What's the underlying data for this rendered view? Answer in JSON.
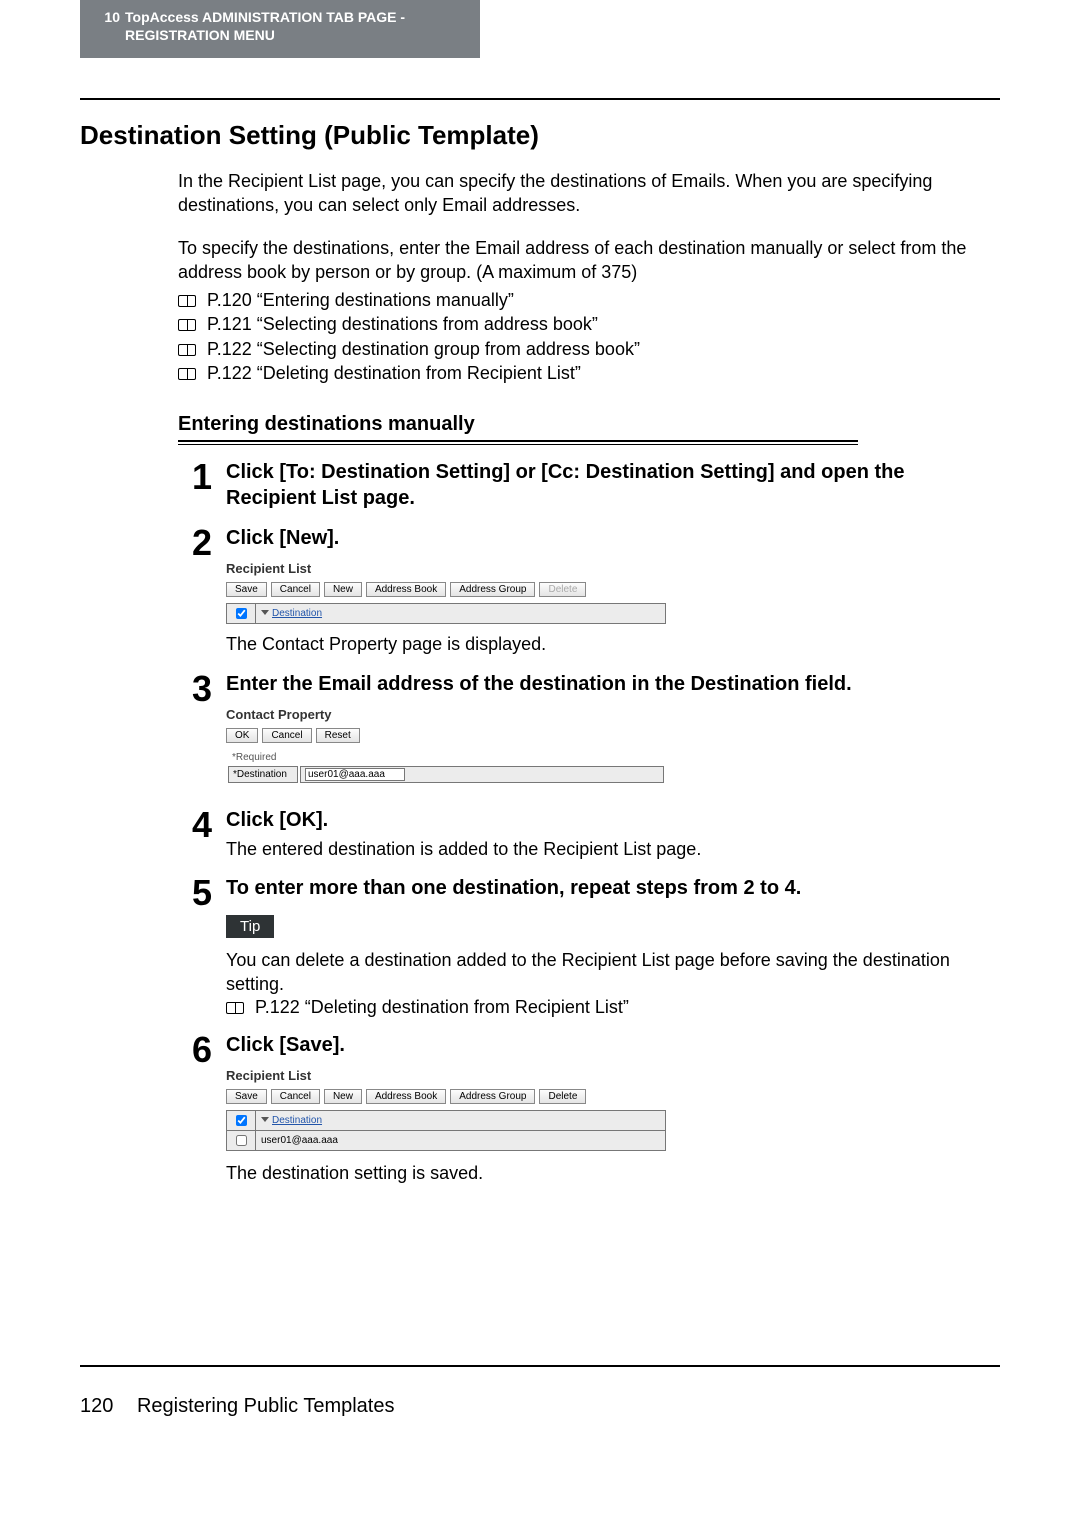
{
  "header": {
    "chapter_number": "10",
    "chapter_title_line1": "TopAccess ADMINISTRATION TAB PAGE -",
    "chapter_title_line2": "REGISTRATION MENU"
  },
  "section_title": "Destination Setting (Public Template)",
  "intro": {
    "p1": "In the Recipient List page, you can specify the destinations of Emails. When you are specifying destinations, you can select only Email addresses.",
    "p2": "To specify the destinations, enter the Email address of each destination manually or select from the address book by person or by group. (A maximum of 375)"
  },
  "refs": [
    "P.120 “Entering destinations manually”",
    "P.121 “Selecting destinations from address book”",
    "P.122 “Selecting destination group from address book”",
    "P.122 “Deleting destination from Recipient List”"
  ],
  "subheading": "Entering destinations manually",
  "steps": {
    "s1": {
      "num": "1",
      "title": "Click [To: Destination Setting] or [Cc: Destination Setting] and open the Recipient List page."
    },
    "s2": {
      "num": "2",
      "title": "Click [New].",
      "after": "The Contact Property page is displayed."
    },
    "s3": {
      "num": "3",
      "title": "Enter the Email address of the destination in the Destination field."
    },
    "s4": {
      "num": "4",
      "title": "Click [OK].",
      "text": "The entered destination is added to the Recipient List page."
    },
    "s5": {
      "num": "5",
      "title": "To enter more than one destination, repeat steps from 2 to 4."
    },
    "s6": {
      "num": "6",
      "title": "Click [Save].",
      "after": "The destination setting is saved."
    }
  },
  "tip": {
    "label": "Tip",
    "body": "You can delete a destination added to the Recipient List page before saving the destination setting.",
    "ref": "P.122 “Deleting destination from Recipient List”"
  },
  "ui": {
    "recipient_list_title": "Recipient List",
    "buttons": {
      "save": "Save",
      "cancel": "Cancel",
      "new": "New",
      "address_book": "Address Book",
      "address_group": "Address Group",
      "delete": "Delete",
      "ok": "OK",
      "reset": "Reset"
    },
    "col_destination": "Destination",
    "contact_property_title": "Contact Property",
    "required_label": "*Required",
    "destination_label": "*Destination",
    "destination_value": "user01@aaa.aaa",
    "row_value": "user01@aaa.aaa"
  },
  "footer": {
    "page_number": "120",
    "running_title": "Registering Public Templates"
  }
}
